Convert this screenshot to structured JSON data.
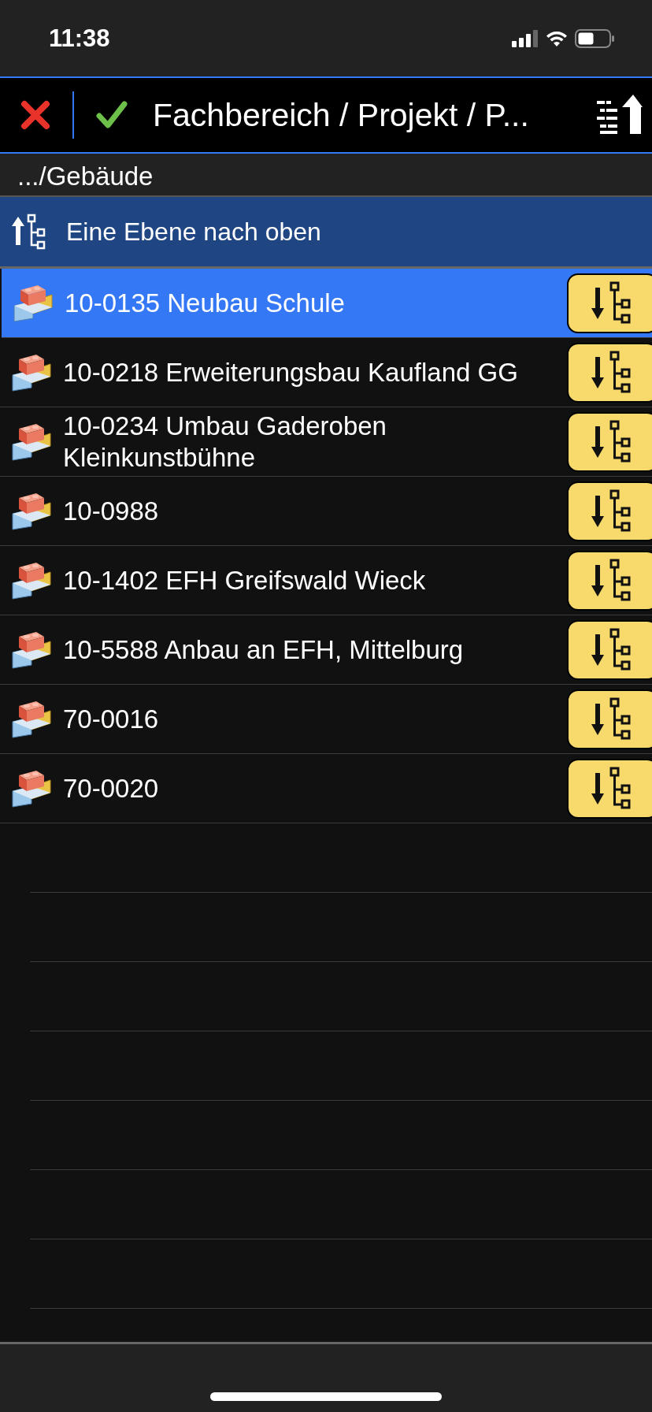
{
  "status_bar": {
    "time": "11:38"
  },
  "header": {
    "title": "Fachbereich / Projekt / P..."
  },
  "breadcrumb": ".../Gebäude",
  "up_row": {
    "label": "Eine Ebene nach oben"
  },
  "items": [
    {
      "label": "10-0135 Neubau Schule",
      "selected": true
    },
    {
      "label": "10-0218 Erweiterungsbau Kaufland GG",
      "selected": false
    },
    {
      "label": "10-0234 Umbau Gaderoben Kleinkunstbühne",
      "selected": false
    },
    {
      "label": "10-0988",
      "selected": false
    },
    {
      "label": "10-1402 EFH Greifswald Wieck",
      "selected": false
    },
    {
      "label": "10-5588 Anbau an EFH, Mittelburg",
      "selected": false
    },
    {
      "label": "70-0016",
      "selected": false
    },
    {
      "label": "70-0020",
      "selected": false
    }
  ]
}
